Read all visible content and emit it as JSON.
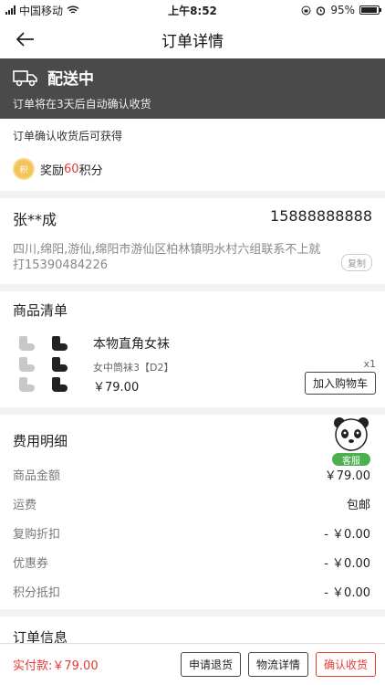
{
  "status_bar": {
    "carrier": "中国移动",
    "time": "上午8:52",
    "battery": "95%"
  },
  "nav": {
    "title": "订单详情"
  },
  "banner": {
    "title": "配送中",
    "subtitle": "订单将在3天后自动确认收货"
  },
  "points": {
    "hint": "订单确认收货后可获得",
    "coin_label": "积",
    "prefix": "奖励",
    "amount": "60",
    "suffix": "积分"
  },
  "address": {
    "name": "张**成",
    "phone": "15888888888",
    "text": "四川,绵阳,游仙,绵阳市游仙区柏林镇明水村六组联系不上就打15390484226",
    "copy_label": "复制"
  },
  "goods": {
    "section_title": "商品清单",
    "items": [
      {
        "name": "本物直角女袜",
        "spec": "女中筒袜3【D2】",
        "qty": "x1",
        "price": "￥79.00",
        "cart_label": "加入购物车"
      }
    ]
  },
  "fees": {
    "title": "费用明细",
    "rows": [
      {
        "label": "商品金额",
        "value": "￥79.00"
      },
      {
        "label": "运费",
        "value": "包邮"
      },
      {
        "label": "复购折扣",
        "value": "- ￥0.00"
      },
      {
        "label": "优惠券",
        "value": "- ￥0.00"
      },
      {
        "label": "积分抵扣",
        "value": "- ￥0.00"
      }
    ],
    "service_label": "客服"
  },
  "order_info": {
    "title": "订单信息"
  },
  "bottom": {
    "total": "实付款:￥79.00",
    "refund_label": "申请退货",
    "logistics_label": "物流详情",
    "confirm_label": "确认收货"
  },
  "colors": {
    "accent": "#e53935",
    "banner_bg": "#4a4a4a",
    "service_green": "#4caf50"
  }
}
